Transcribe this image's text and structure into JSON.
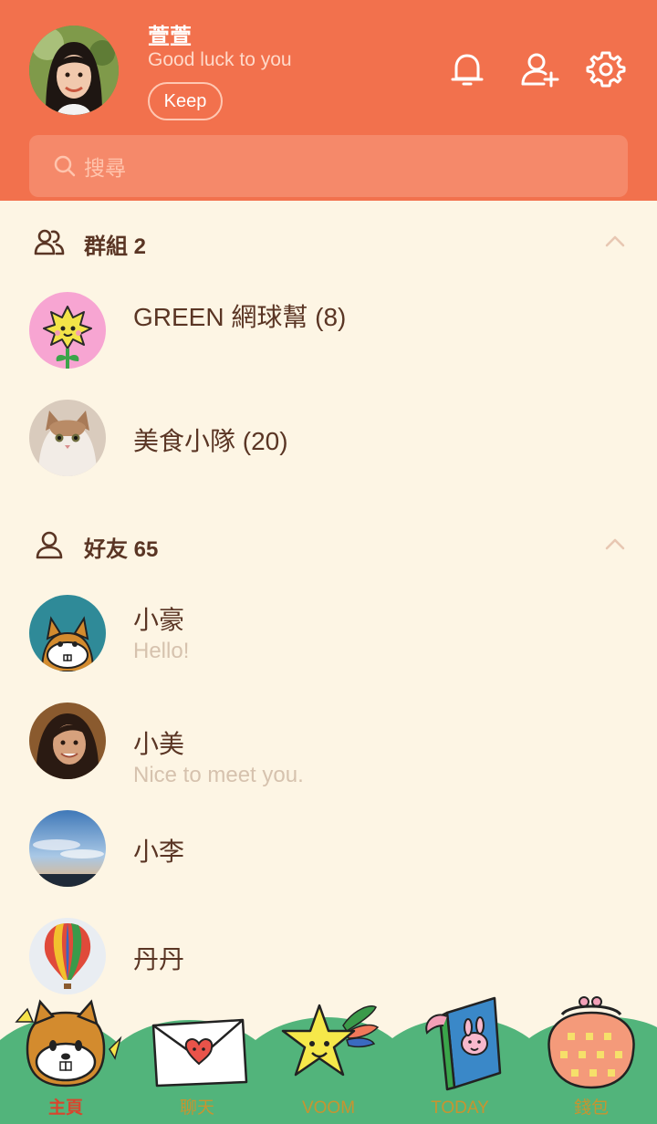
{
  "profile": {
    "name": "萱萱",
    "status": "Good luck to you",
    "keep_label": "Keep"
  },
  "search": {
    "placeholder": "搜尋"
  },
  "groups": {
    "title": "群組 2",
    "items": [
      {
        "name": "GREEN 網球幫 (8)"
      },
      {
        "name": "美食小隊 (20)"
      }
    ]
  },
  "friends": {
    "title": "好友 65",
    "items": [
      {
        "name": "小豪",
        "status": "Hello!"
      },
      {
        "name": "小美",
        "status": "Nice to meet you."
      },
      {
        "name": "小李",
        "status": ""
      },
      {
        "name": "丹丹",
        "status": ""
      }
    ]
  },
  "tabs": [
    {
      "label": "主頁",
      "active": true
    },
    {
      "label": "聊天",
      "active": false
    },
    {
      "label": "VOOM",
      "active": false
    },
    {
      "label": "TODAY",
      "active": false
    },
    {
      "label": "錢包",
      "active": false
    }
  ],
  "colors": {
    "header": "#f2714d",
    "background": "#fdf5e4",
    "text_primary": "#5a3524",
    "text_secondary": "#d6c2ae",
    "tab_active": "#d9452d",
    "tab_inactive": "#c79430",
    "tabbar_green": "#52b47b"
  },
  "icons": {
    "header": [
      "bell-icon",
      "add-friend-icon",
      "settings-icon"
    ],
    "search": "search-icon",
    "groups": "group-icon",
    "friends": "person-icon",
    "collapse": "chevron-up-icon"
  }
}
